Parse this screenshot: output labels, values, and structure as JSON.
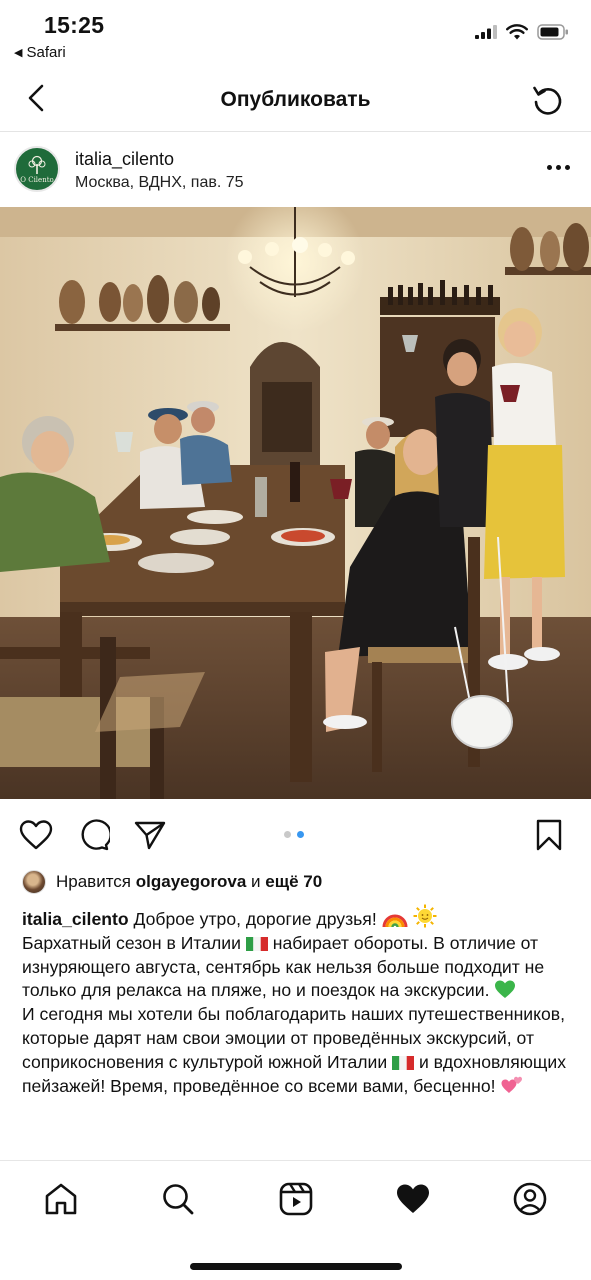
{
  "status_bar": {
    "time": "15:25",
    "back_app": "Safari",
    "icons": [
      "signal-icon",
      "wifi-icon",
      "battery-icon"
    ]
  },
  "nav": {
    "title": "Опубликовать",
    "back_icon": "chevron-left-icon",
    "refresh_icon": "refresh-icon"
  },
  "post": {
    "username": "italia_cilento",
    "location": "Москва, ВДНХ, пав. 75",
    "avatar_text": "O Cilento",
    "carousel": {
      "total": 2,
      "current": 2
    }
  },
  "likes": {
    "prefix": "Нравится",
    "user": "olgayegorova",
    "connector": "и",
    "more": "ещё 70"
  },
  "caption": {
    "username": "italia_cilento",
    "line1": "Доброе утро, дорогие друзья!",
    "p1_a": "Бархатный сезон в Италии",
    "p1_b": "набирает обороты. В отличие от изнуряющего августа, сентябрь как нельзя больше подходит не только для релакса на пляже, но и поездок на экскурсии.",
    "p2_a": "И сегодня мы хотели бы поблагодарить  наших путешественников, которые дарят нам свои эмоции от проведённых экскурсий, от соприкосновения с культурой южной Италии",
    "p2_b": "и вдохновляющих пейзажей! Время, проведённое со всеми вами, бесценно!"
  },
  "bottom_nav": {
    "tabs": [
      "home-icon",
      "search-icon",
      "reels-icon",
      "heart-filled-icon",
      "profile-icon"
    ]
  },
  "colors": {
    "accent_blue": "#3897f0",
    "logo_green": "#1f6b3a",
    "text": "#111111"
  }
}
